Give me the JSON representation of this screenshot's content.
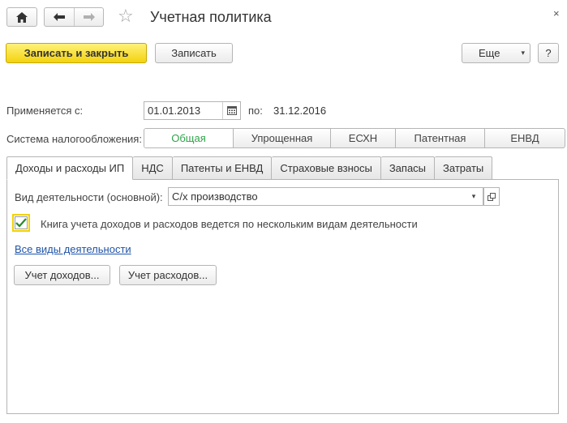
{
  "nav": {
    "home_icon": "home-icon",
    "back_icon": "arrow-left-icon",
    "forward_icon": "arrow-right-icon",
    "favorite_icon": "star-icon",
    "close_icon": "close-icon",
    "close_glyph": "×"
  },
  "window": {
    "title": "Учетная политика"
  },
  "toolbar": {
    "save_close_label": "Записать и закрыть",
    "save_label": "Записать",
    "more_label": "Еще",
    "more_arrow": "▾",
    "help_label": "?"
  },
  "period": {
    "applies_from_label": "Применяется с:",
    "applies_from_value": "01.01.2013",
    "to_label": "по:",
    "to_value": "31.12.2016"
  },
  "tax_system": {
    "label": "Система налогообложения:",
    "options": [
      "Общая",
      "Упрощенная",
      "ЕСХН",
      "Патентная",
      "ЕНВД"
    ],
    "selected": "Общая"
  },
  "tabs": [
    "Доходы и расходы ИП",
    "НДС",
    "Патенты и ЕНВД",
    "Страховые взносы",
    "Запасы",
    "Затраты"
  ],
  "income_tab": {
    "activity_label": "Вид деятельности (основной):",
    "activity_value": "С/х производство",
    "multi_activity_label": "Книга учета доходов и расходов ведется по нескольким видам деятельности",
    "multi_activity_checked": true,
    "all_activities_link": "Все виды деятельности",
    "income_button": "Учет доходов...",
    "expense_button": "Учет расходов..."
  },
  "colors": {
    "primary_button": "#f3d20f",
    "active_segment_text": "#2fa349",
    "link": "#1f54a8",
    "checkbox_focus": "#f2d200"
  }
}
